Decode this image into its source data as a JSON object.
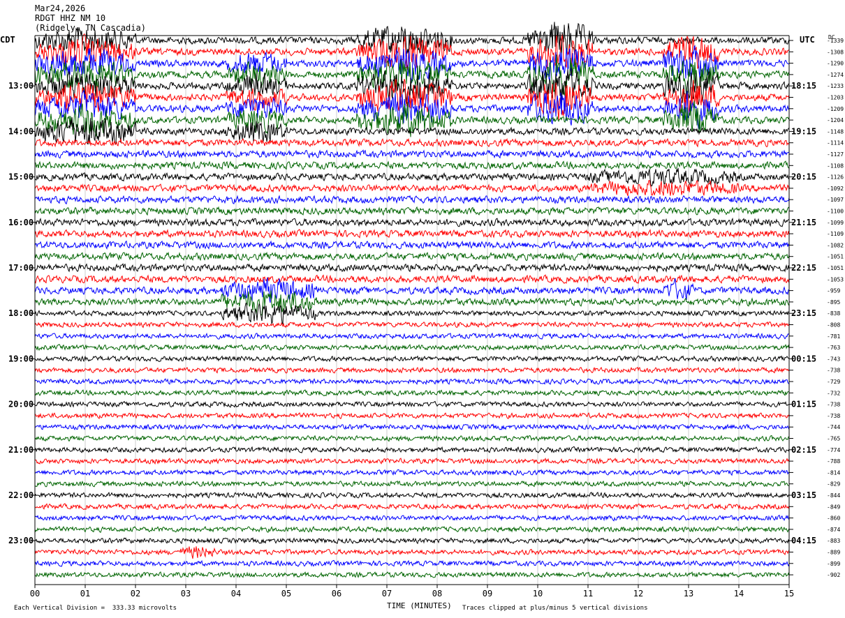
{
  "header": {
    "date": "Mar24,2026",
    "station": "RDGT HHZ NM 10",
    "location": "(Ridgely, TN Cascadia)"
  },
  "labels": {
    "left_tz": "CDT",
    "right_tz": "UTC",
    "dc_header": "DC",
    "x_axis_title": "TIME (MINUTES)",
    "scale_note": "Each Vertical Division =  333.33 microvolts",
    "clip_note": "Traces clipped at plus/minus 5 vertical divisions"
  },
  "chart_data": {
    "type": "line",
    "title": "",
    "xlabel": "TIME (MINUTES)",
    "ylabel": "",
    "xlim": [
      0,
      15
    ],
    "x_ticks": [
      "00",
      "01",
      "02",
      "03",
      "04",
      "05",
      "06",
      "07",
      "08",
      "09",
      "10",
      "11",
      "12",
      "13",
      "14",
      "15"
    ],
    "rows_per_hour": 4,
    "minutes_per_row": 15,
    "left_hour_labels": [
      "13:00",
      "14:00",
      "15:00",
      "16:00",
      "17:00",
      "18:00",
      "19:00",
      "20:00",
      "21:00",
      "22:00",
      "23:00"
    ],
    "right_hour_labels": [
      "18:15",
      "19:15",
      "20:15",
      "21:15",
      "22:15",
      "23:15",
      "00:15",
      "01:15",
      "02:15",
      "03:15",
      "04:15"
    ],
    "trace_colors": [
      "#000000",
      "#ff0000",
      "#0000ff",
      "#006400"
    ],
    "dc_offsets": [
      -1339,
      -1308,
      -1290,
      -1274,
      -1233,
      -1203,
      -1209,
      -1204,
      -1148,
      -1114,
      -1127,
      -1108,
      -1126,
      -1092,
      -1097,
      -1100,
      -1099,
      -1109,
      -1082,
      -1051,
      -1051,
      -1053,
      -959,
      -895,
      -838,
      -808,
      -781,
      -763,
      -743,
      -738,
      -729,
      -732,
      -738,
      -738,
      -744,
      -765,
      -774,
      -788,
      -814,
      -829,
      -844,
      -849,
      -860,
      -874,
      -883,
      -889,
      -899,
      -902
    ],
    "grid": true,
    "clip_divisions": 5
  }
}
